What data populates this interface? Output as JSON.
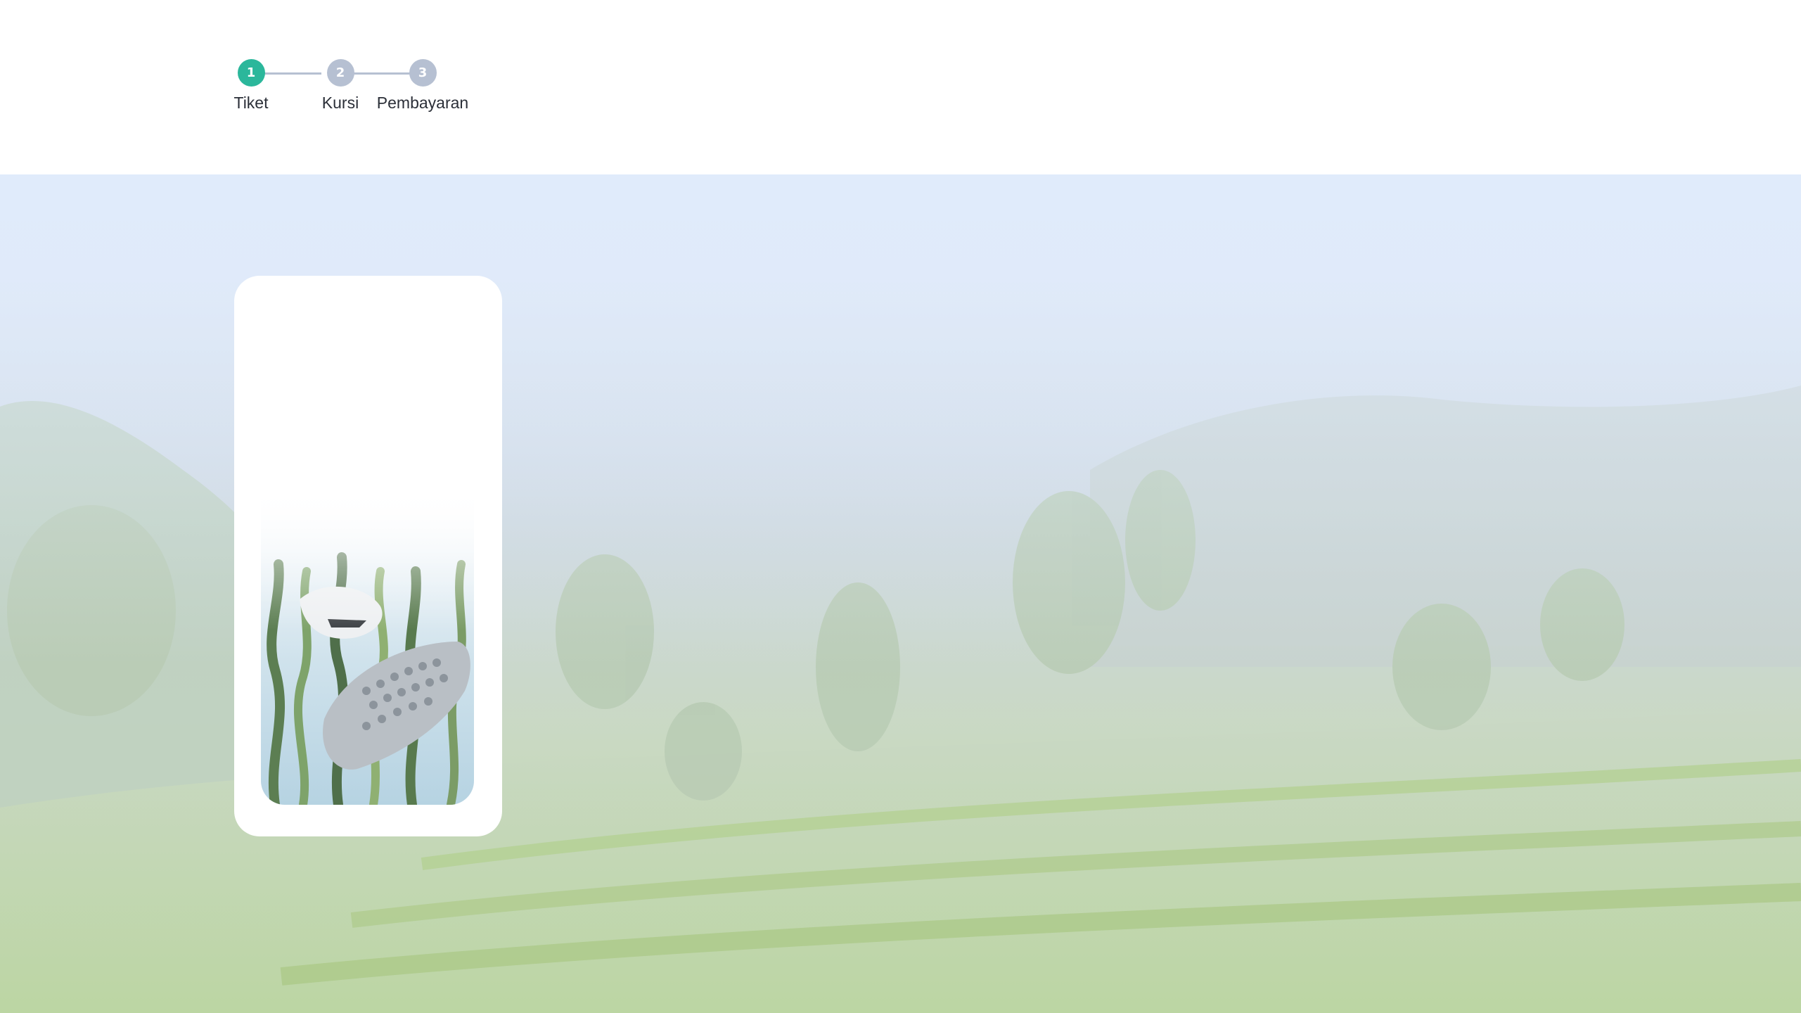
{
  "stepper": {
    "steps": [
      {
        "number": "1",
        "label": "Tiket",
        "state": "active"
      },
      {
        "number": "2",
        "label": "Kursi",
        "state": "inactive"
      },
      {
        "number": "3",
        "label": "Pembayaran",
        "state": "inactive"
      }
    ],
    "active_color": "#2bb79b",
    "inactive_color": "#b6c0d2"
  },
  "hero": {
    "background": "misty rice terrace landscape"
  },
  "card": {
    "image": "crocodile and shark sculpture among seaweed"
  }
}
